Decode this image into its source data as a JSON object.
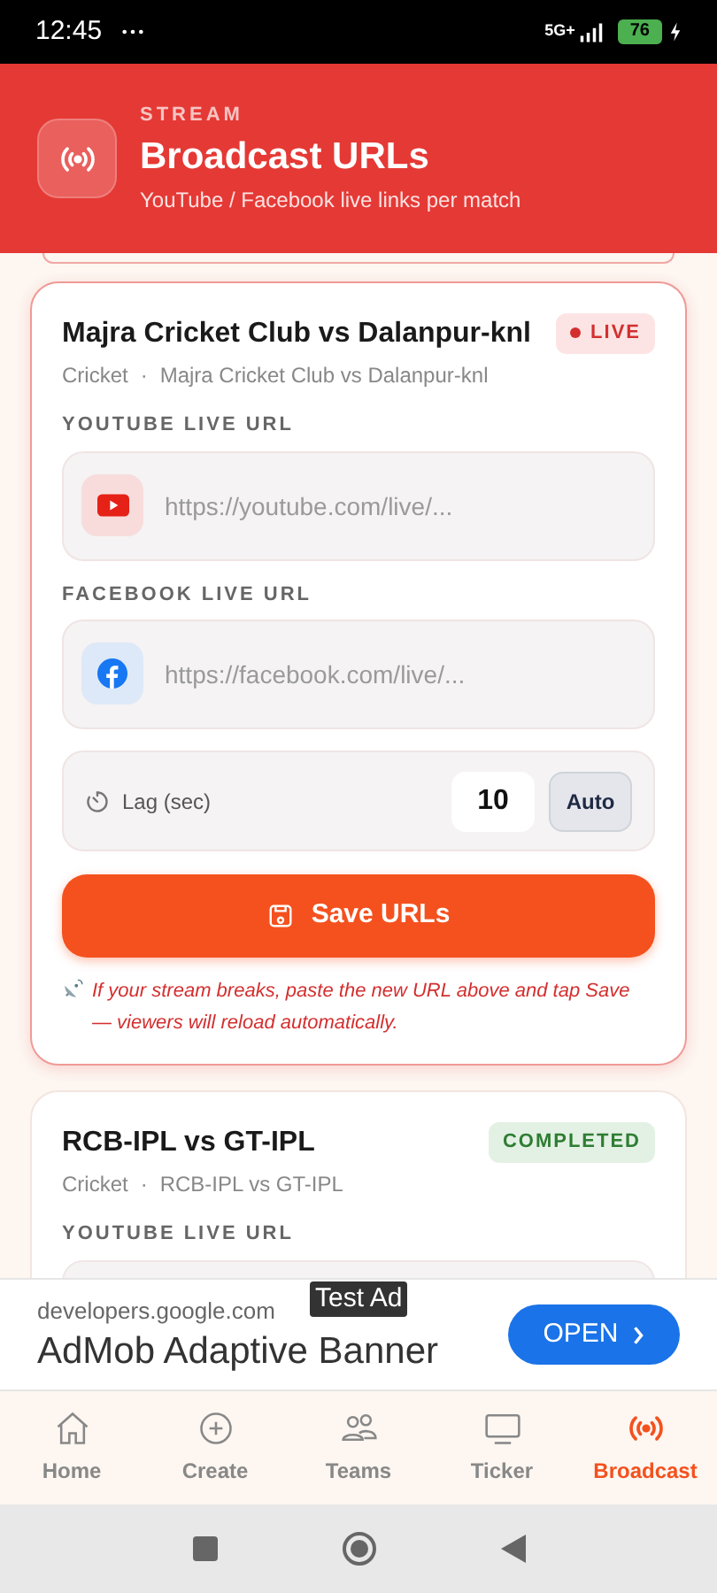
{
  "status_bar": {
    "time": "12:45",
    "network": "5G+",
    "battery": "76"
  },
  "header": {
    "eyebrow": "STREAM",
    "title": "Broadcast URLs",
    "subtitle": "YouTube / Facebook live links per match"
  },
  "matches": [
    {
      "title": "Majra Cricket Club vs Dalanpur-knl",
      "sport": "Cricket",
      "separator": "·",
      "subtitle": "Majra Cricket Club vs Dalanpur-knl",
      "status": {
        "label": "LIVE",
        "kind": "live"
      },
      "youtube": {
        "label": "YOUTUBE LIVE URL",
        "placeholder": "https://youtube.com/live/..."
      },
      "facebook": {
        "label": "FACEBOOK LIVE URL",
        "placeholder": "https://facebook.com/live/..."
      },
      "lag": {
        "label": "Lag (sec)",
        "value": "10",
        "auto_button": "Auto"
      },
      "save_button": "Save URLs",
      "note": "If your stream breaks, paste the new URL above and tap Save — viewers will reload automatically."
    },
    {
      "title": "RCB-IPL vs GT-IPL",
      "sport": "Cricket",
      "separator": "·",
      "subtitle": "RCB-IPL vs GT-IPL",
      "status": {
        "label": "COMPLETED",
        "kind": "completed"
      },
      "youtube": {
        "label": "YOUTUBE LIVE URL"
      }
    }
  ],
  "ad": {
    "badge": "Test Ad",
    "domain": "developers.google.com",
    "title": "AdMob Adaptive Banner",
    "button": "OPEN"
  },
  "nav": [
    {
      "label": "Home",
      "kind": "home",
      "selected": false
    },
    {
      "label": "Create",
      "kind": "create",
      "selected": false
    },
    {
      "label": "Teams",
      "kind": "teams",
      "selected": false
    },
    {
      "label": "Ticker",
      "kind": "ticker",
      "selected": false
    },
    {
      "label": "Broadcast",
      "kind": "broadcast",
      "selected": true
    }
  ]
}
